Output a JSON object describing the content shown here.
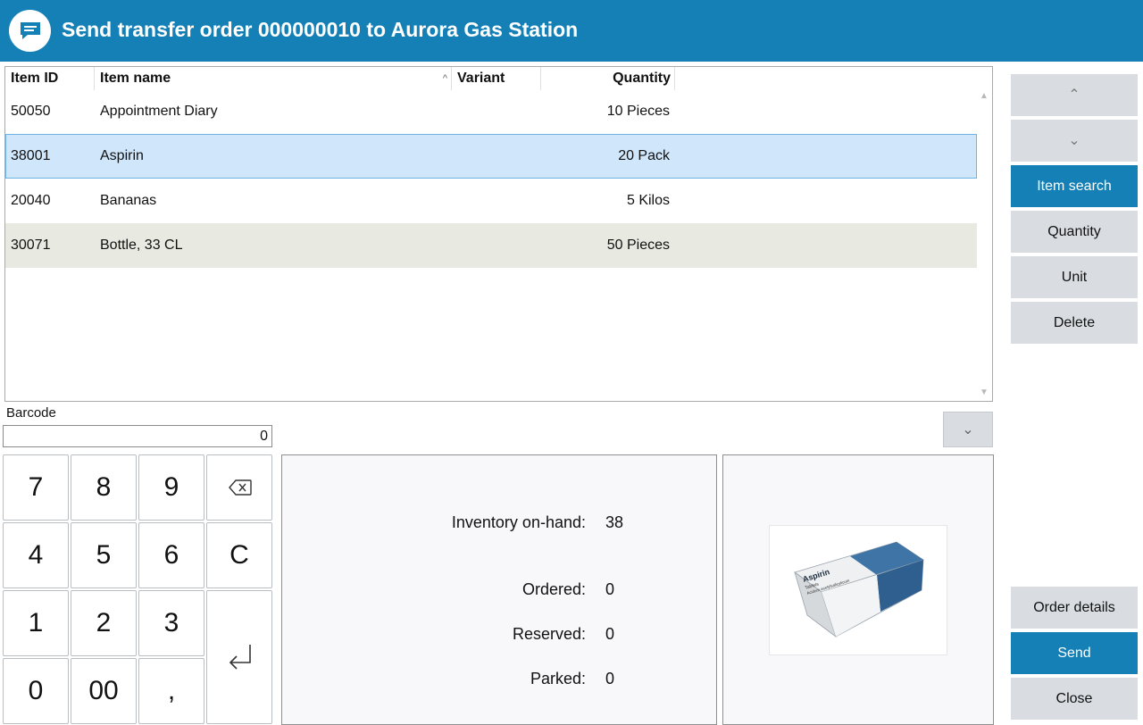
{
  "window": {
    "title": "Send transfer order 000000010 to Aurora Gas Station",
    "icon": "chat-icon",
    "accent": "#1580b5"
  },
  "grid": {
    "columns": [
      "Item ID",
      "Item name",
      "Variant",
      "Quantity"
    ],
    "sorted_column": "Item name",
    "rows": [
      {
        "id": "50050",
        "name": "Appointment Diary",
        "variant": "",
        "quantity": "10 Pieces"
      },
      {
        "id": "38001",
        "name": "Aspirin",
        "variant": "",
        "quantity": "20 Pack"
      },
      {
        "id": "20040",
        "name": "Bananas",
        "variant": "",
        "quantity": "5 Kilos"
      },
      {
        "id": "30071",
        "name": "Bottle, 33 CL",
        "variant": "",
        "quantity": "50 Pieces"
      }
    ],
    "selected_row": 1
  },
  "barcode": {
    "label": "Barcode",
    "value": "0"
  },
  "numpad": {
    "keys": [
      "7",
      "8",
      "9",
      "backspace",
      "4",
      "5",
      "6",
      "C",
      "1",
      "2",
      "3",
      "enter",
      "0",
      "00",
      ","
    ]
  },
  "inventory": {
    "on_hand_label": "Inventory on-hand:",
    "on_hand_value": "38",
    "ordered_label": "Ordered:",
    "ordered_value": "0",
    "reserved_label": "Reserved:",
    "reserved_value": "0",
    "parked_label": "Parked:",
    "parked_value": "0"
  },
  "product_image": {
    "box_text_title": "Aspirin",
    "box_text_sub": "Tablets",
    "box_text_sub2": "Acidum acetylsalicylicum"
  },
  "side_buttons": {
    "item_search": "Item search",
    "quantity": "Quantity",
    "unit": "Unit",
    "delete": "Delete",
    "order_details": "Order details",
    "send": "Send",
    "close": "Close"
  },
  "colors": {
    "primary": "#1580b5",
    "button_gray": "#d9dde1",
    "selected_row": "#cfe6fb",
    "alt_row": "#e8eae1"
  }
}
